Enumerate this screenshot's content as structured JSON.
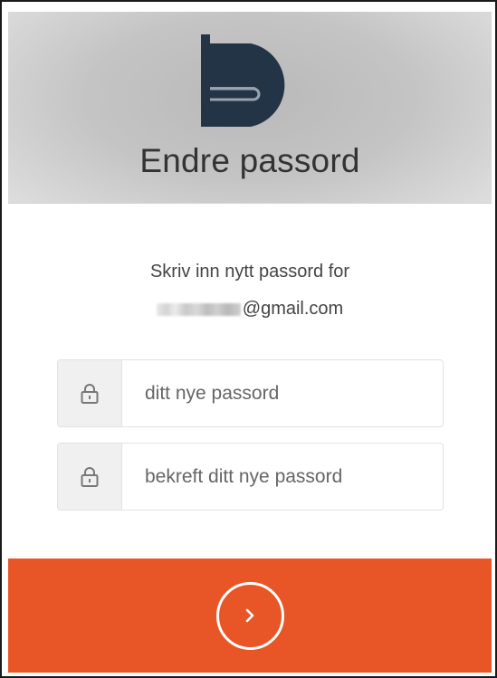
{
  "header": {
    "logo": "brand-logo",
    "title": "Endre passord"
  },
  "form": {
    "prompt": "Skriv inn nytt passord for",
    "email_domain": "@gmail.com",
    "new_password": {
      "placeholder": "ditt nye passord",
      "icon": "lock-icon"
    },
    "confirm_password": {
      "placeholder": "bekreft ditt nye passord",
      "icon": "lock-icon"
    },
    "submit": {
      "icon": "chevron-right-icon"
    }
  },
  "colors": {
    "logo": "#243447",
    "accent": "#e85526",
    "header_bg": "#c4c4c4",
    "text": "#333333"
  }
}
